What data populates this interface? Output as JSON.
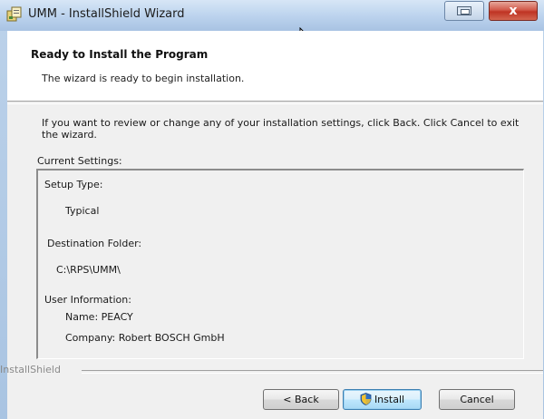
{
  "window": {
    "title": "UMM - InstallShield Wizard"
  },
  "header": {
    "title": "Ready to Install the Program",
    "subtitle": "The wizard is ready to begin installation."
  },
  "body": {
    "instruction": "If you want to review or change any of your installation settings, click Back. Click Cancel to exit the wizard.",
    "current_settings_label": "Current Settings:"
  },
  "settings": {
    "setup_type_label": "Setup Type:",
    "setup_type_value": "Typical",
    "destination_label": "Destination Folder:",
    "destination_value": "C:\\RPS\\UMM\\",
    "user_info_label": "User Information:",
    "name": "Name: PEACY",
    "company": "Company: Robert BOSCH GmbH"
  },
  "footer": {
    "brand": "InstallShield",
    "back_label": "< Back",
    "install_label": "Install",
    "cancel_label": "Cancel"
  },
  "titlebar": {
    "close_label": "x"
  },
  "icons": {
    "app": "installer-app-icon",
    "restore": "restore-icon",
    "close": "close-icon",
    "shield": "uac-shield-icon",
    "cursor": "mouse-cursor-icon"
  },
  "colors": {
    "titlebar": "#bdd4ee",
    "client": "#f0f0f0",
    "close_button": "#c8402f",
    "default_button": "#a7d9f5"
  }
}
